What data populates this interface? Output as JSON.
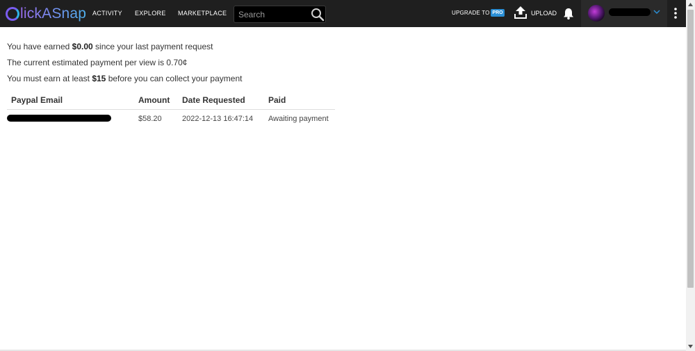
{
  "navbar": {
    "logo_text": "lickASnap",
    "links": [
      "ACTIVITY",
      "EXPLORE",
      "MARKETPLACE"
    ],
    "search_placeholder": "Search",
    "upgrade_label": "UPGRADE TO",
    "pro_badge": "PRO",
    "upload_label": "UPLOAD",
    "brand_color": "#8a6ce8",
    "pro_color": "#2b8fd6",
    "icons": [
      "search-icon",
      "upload-icon",
      "bell-icon",
      "chevron-down-icon",
      "kebab-menu-icon"
    ]
  },
  "earnings": {
    "line1_prefix": "You have earned",
    "line1_amount": "$0.00",
    "line1_suffix": "since your last payment request",
    "line2": "The current estimated payment per view is 0.70¢",
    "line3_prefix": "You must earn at least",
    "line3_amount": "$15",
    "line3_suffix": "before you can collect your payment"
  },
  "table": {
    "headers": [
      "Paypal Email",
      "Amount",
      "Date Requested",
      "Paid"
    ],
    "rows": [
      {
        "amount": "$58.20",
        "date": "2022-12-13 16:47:14",
        "paid": "Awaiting payment"
      }
    ]
  }
}
